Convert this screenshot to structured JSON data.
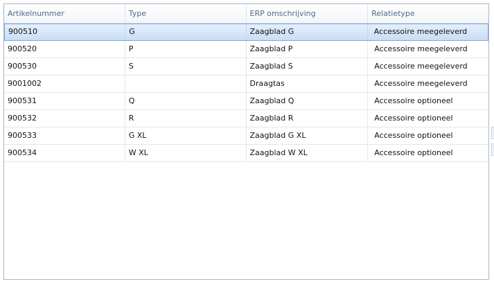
{
  "grid": {
    "columns": [
      "Artikelnummer",
      "Type",
      "ERP omschrijving",
      "Relatietype"
    ],
    "rows": [
      {
        "artikelnummer": "900510",
        "type": "G",
        "erp": "Zaagblad G",
        "relatie": "Accessoire meegeleverd"
      },
      {
        "artikelnummer": "900520",
        "type": "P",
        "erp": "Zaagblad P",
        "relatie": "Accessoire meegeleverd"
      },
      {
        "artikelnummer": "900530",
        "type": "S",
        "erp": "Zaagblad S",
        "relatie": "Accessoire meegeleverd"
      },
      {
        "artikelnummer": "9001002",
        "type": "",
        "erp": "Draagtas",
        "relatie": "Accessoire meegeleverd"
      },
      {
        "artikelnummer": "900531",
        "type": "Q",
        "erp": "Zaagblad Q",
        "relatie": "Accessoire optioneel"
      },
      {
        "artikelnummer": "900532",
        "type": "R",
        "erp": "Zaagblad R",
        "relatie": "Accessoire optioneel"
      },
      {
        "artikelnummer": "900533",
        "type": "G XL",
        "erp": "Zaagblad G XL",
        "relatie": "Accessoire optioneel"
      },
      {
        "artikelnummer": "900534",
        "type": "W XL",
        "erp": "Zaagblad W XL",
        "relatie": "Accessoire optioneel"
      }
    ],
    "selected_row": 0
  }
}
